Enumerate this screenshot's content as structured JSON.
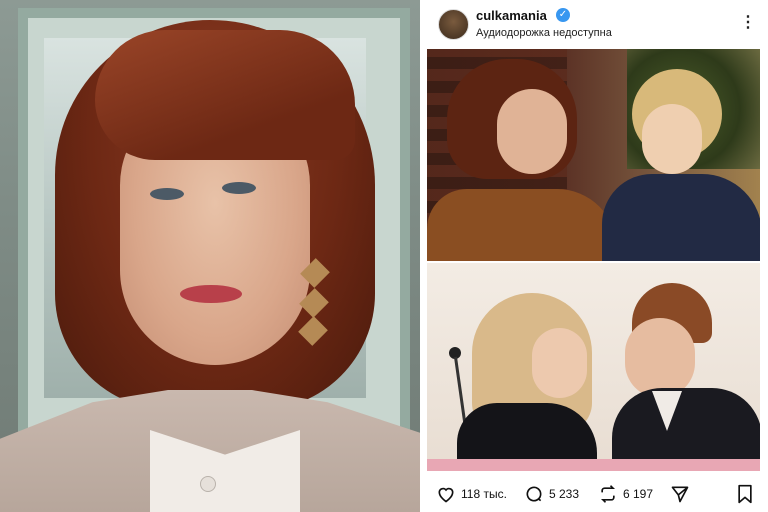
{
  "post": {
    "username": "culkamania",
    "subtitle": "Аудиодорожка недоступна",
    "menu_icon": "⋮",
    "verified_icon": "✓",
    "likes": "118 тыс.",
    "comments": "5 233",
    "reposts": "6 197"
  },
  "colors": {
    "verified": "#3897f0",
    "text": "#111111"
  },
  "icons": [
    "heart-icon",
    "comment-icon",
    "repost-icon",
    "share-icon",
    "bookmark-icon",
    "more-icon",
    "verified-icon"
  ]
}
